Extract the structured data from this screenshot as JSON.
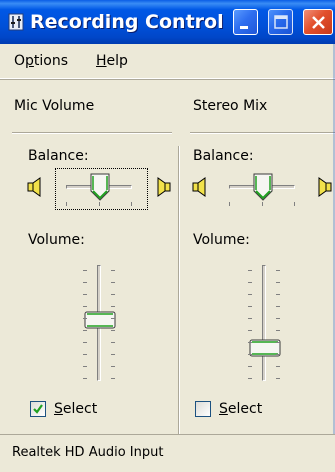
{
  "window": {
    "title": "Recording Control",
    "titlebar_color": "#0058e6",
    "close_button_color": "#e2502d"
  },
  "menu": {
    "items": [
      {
        "label": "Options",
        "mnemonic": "p"
      },
      {
        "label": "Help",
        "mnemonic": "H"
      }
    ]
  },
  "channels": [
    {
      "name": "Mic Volume",
      "balance_label": "Balance:",
      "balance_value": 0.5,
      "balance_focused": true,
      "volume_label": "Volume:",
      "volume_level": 0.55,
      "select_label": "Select",
      "selected": true
    },
    {
      "name": "Stereo Mix",
      "balance_label": "Balance:",
      "balance_value": 0.5,
      "balance_focused": false,
      "volume_label": "Volume:",
      "volume_level": 0.2,
      "select_label": "Select",
      "selected": false
    }
  ],
  "icons": {
    "left_speaker": "speaker-left-icon",
    "right_speaker": "speaker-right-icon",
    "app_icon": "recording-control-app-icon"
  },
  "status": {
    "text": "Realtek HD Audio Input"
  }
}
